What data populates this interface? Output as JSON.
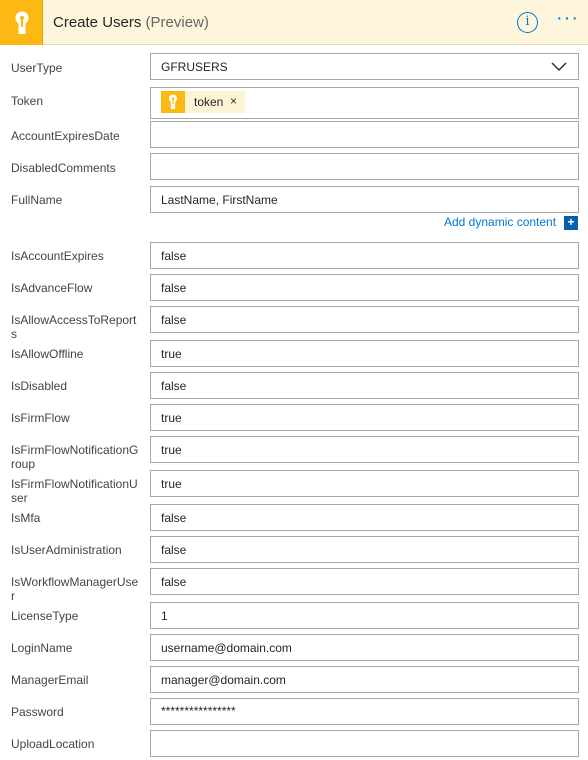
{
  "header": {
    "title": "Create Users",
    "subtitle": "(Preview)",
    "logo_icon": "keyhole-icon",
    "info_icon": "info-icon",
    "more_icon": "more-options-icon",
    "more_glyph": "···",
    "info_glyph": "i",
    "accent_color": "#fdb913",
    "brand_blue": "#0078d4"
  },
  "fields": {
    "usertype": {
      "label": "UserType",
      "value": "GFRUSERS"
    },
    "token": {
      "label": "Token",
      "chip_label": "token",
      "chip_remove": "×"
    },
    "account_expires_date": {
      "label": "AccountExpiresDate",
      "value": ""
    },
    "disabled_comments": {
      "label": "DisabledComments",
      "value": ""
    },
    "full_name": {
      "label": "FullName",
      "value": "LastName, FirstName"
    },
    "is_account_expires": {
      "label": "IsAccountExpires",
      "value": "false"
    },
    "is_advance_flow": {
      "label": "IsAdvanceFlow",
      "value": "false"
    },
    "is_allow_access_to_reports": {
      "label": "IsAllowAccessToReports",
      "value": "false"
    },
    "is_allow_offline": {
      "label": "IsAllowOffline",
      "value": "true"
    },
    "is_disabled": {
      "label": "IsDisabled",
      "value": "false"
    },
    "is_firm_flow": {
      "label": "IsFirmFlow",
      "value": "true"
    },
    "is_firm_flow_notification_group": {
      "label": "IsFirmFlowNotificationGroup",
      "value": "true"
    },
    "is_firm_flow_notification_user": {
      "label": "IsFirmFlowNotificationUser",
      "value": "true"
    },
    "is_mfa": {
      "label": "IsMfa",
      "value": "false"
    },
    "is_user_administration": {
      "label": "IsUserAdministration",
      "value": "false"
    },
    "is_workflow_manager_user": {
      "label": "IsWorkflowManagerUser",
      "value": "false"
    },
    "license_type": {
      "label": "LicenseType",
      "value": "1"
    },
    "login_name": {
      "label": "LoginName",
      "value": "username@domain.com"
    },
    "manager_email": {
      "label": "ManagerEmail",
      "value": "manager@domain.com"
    },
    "password": {
      "label": "Password",
      "value": "****************"
    },
    "upload_location": {
      "label": "UploadLocation",
      "value": ""
    }
  },
  "dynamic_content": {
    "label": "Add dynamic content",
    "plus": "+"
  }
}
